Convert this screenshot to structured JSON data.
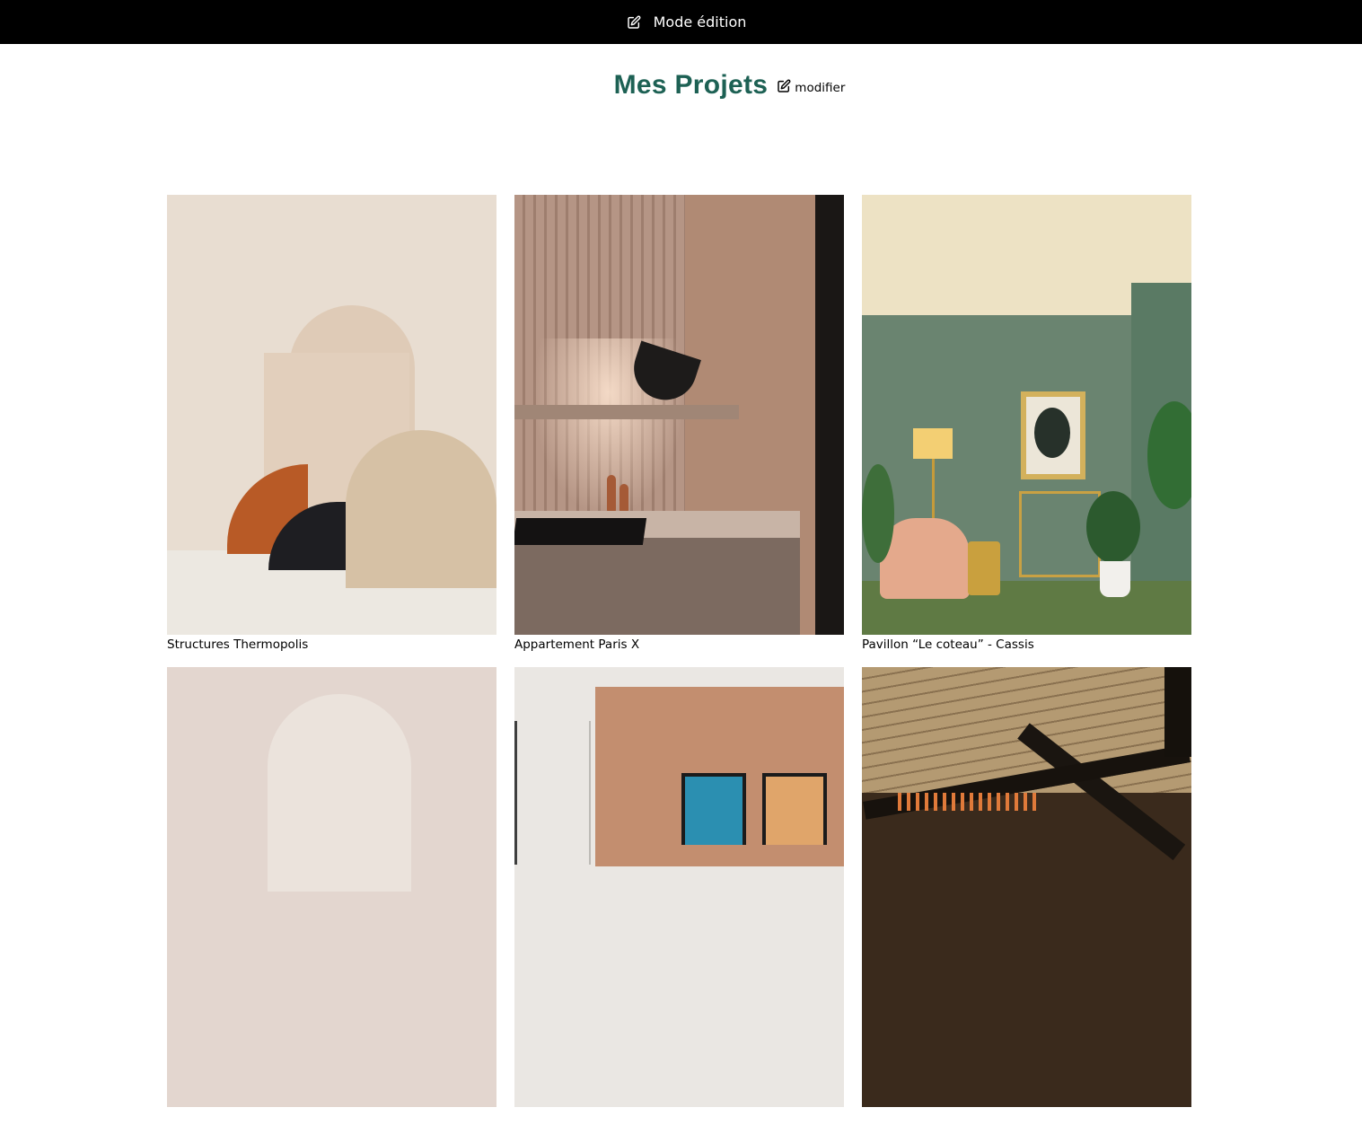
{
  "topbar": {
    "edit_mode_label": "Mode édition",
    "icon": "edit-icon"
  },
  "header": {
    "title": "Mes Projets",
    "modify_label": "modifier",
    "title_color": "#1d6154"
  },
  "gallery": {
    "items": [
      {
        "caption": "Structures Thermopolis",
        "image": "structures-thermopolis"
      },
      {
        "caption": "Appartement Paris X",
        "image": "appartement-paris-x"
      },
      {
        "caption": "Pavillon “Le coteau” - Cassis",
        "image": "pavillon-le-coteau-cassis"
      },
      {
        "caption": "",
        "image": "project-4"
      },
      {
        "caption": "",
        "image": "project-5"
      },
      {
        "caption": "",
        "image": "project-6"
      }
    ]
  }
}
